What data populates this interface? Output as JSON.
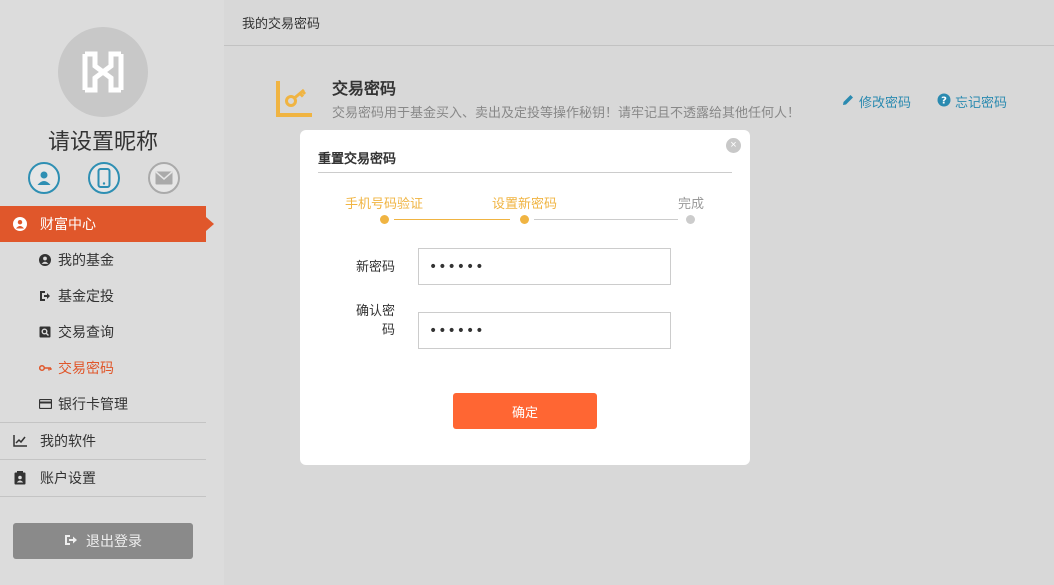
{
  "sidebar": {
    "nickname": "请设置昵称",
    "nav": {
      "wealth_center": "财富中心",
      "my_funds": "我的基金",
      "fund_plan": "基金定投",
      "trade_query": "交易查询",
      "trade_password": "交易密码",
      "bank_card": "银行卡管理",
      "my_software": "我的软件",
      "account_settings": "账户设置"
    },
    "logout_label": "退出登录"
  },
  "main": {
    "breadcrumb": "我的交易密码",
    "section_title": "交易密码",
    "section_desc": "交易密码用于基金买入、卖出及定投等操作秘钥！请牢记且不透露给其他任何人！",
    "modify_password": "修改密码",
    "forgot_password": "忘记密码"
  },
  "modal": {
    "title": "重置交易密码",
    "close_label": "×",
    "steps": [
      {
        "label": "手机号码验证",
        "state": "done"
      },
      {
        "label": "设置新密码",
        "state": "done"
      },
      {
        "label": "完成",
        "state": "todo"
      }
    ],
    "new_password_label": "新密码",
    "new_password_value": "••••••",
    "confirm_password_label": "确认密码",
    "confirm_password_value": "••••••",
    "confirm_button": "确定"
  },
  "colors": {
    "accent": "#e0572b",
    "step_active": "#f0b442",
    "link": "#2a8ab0",
    "button": "#ff6633"
  }
}
